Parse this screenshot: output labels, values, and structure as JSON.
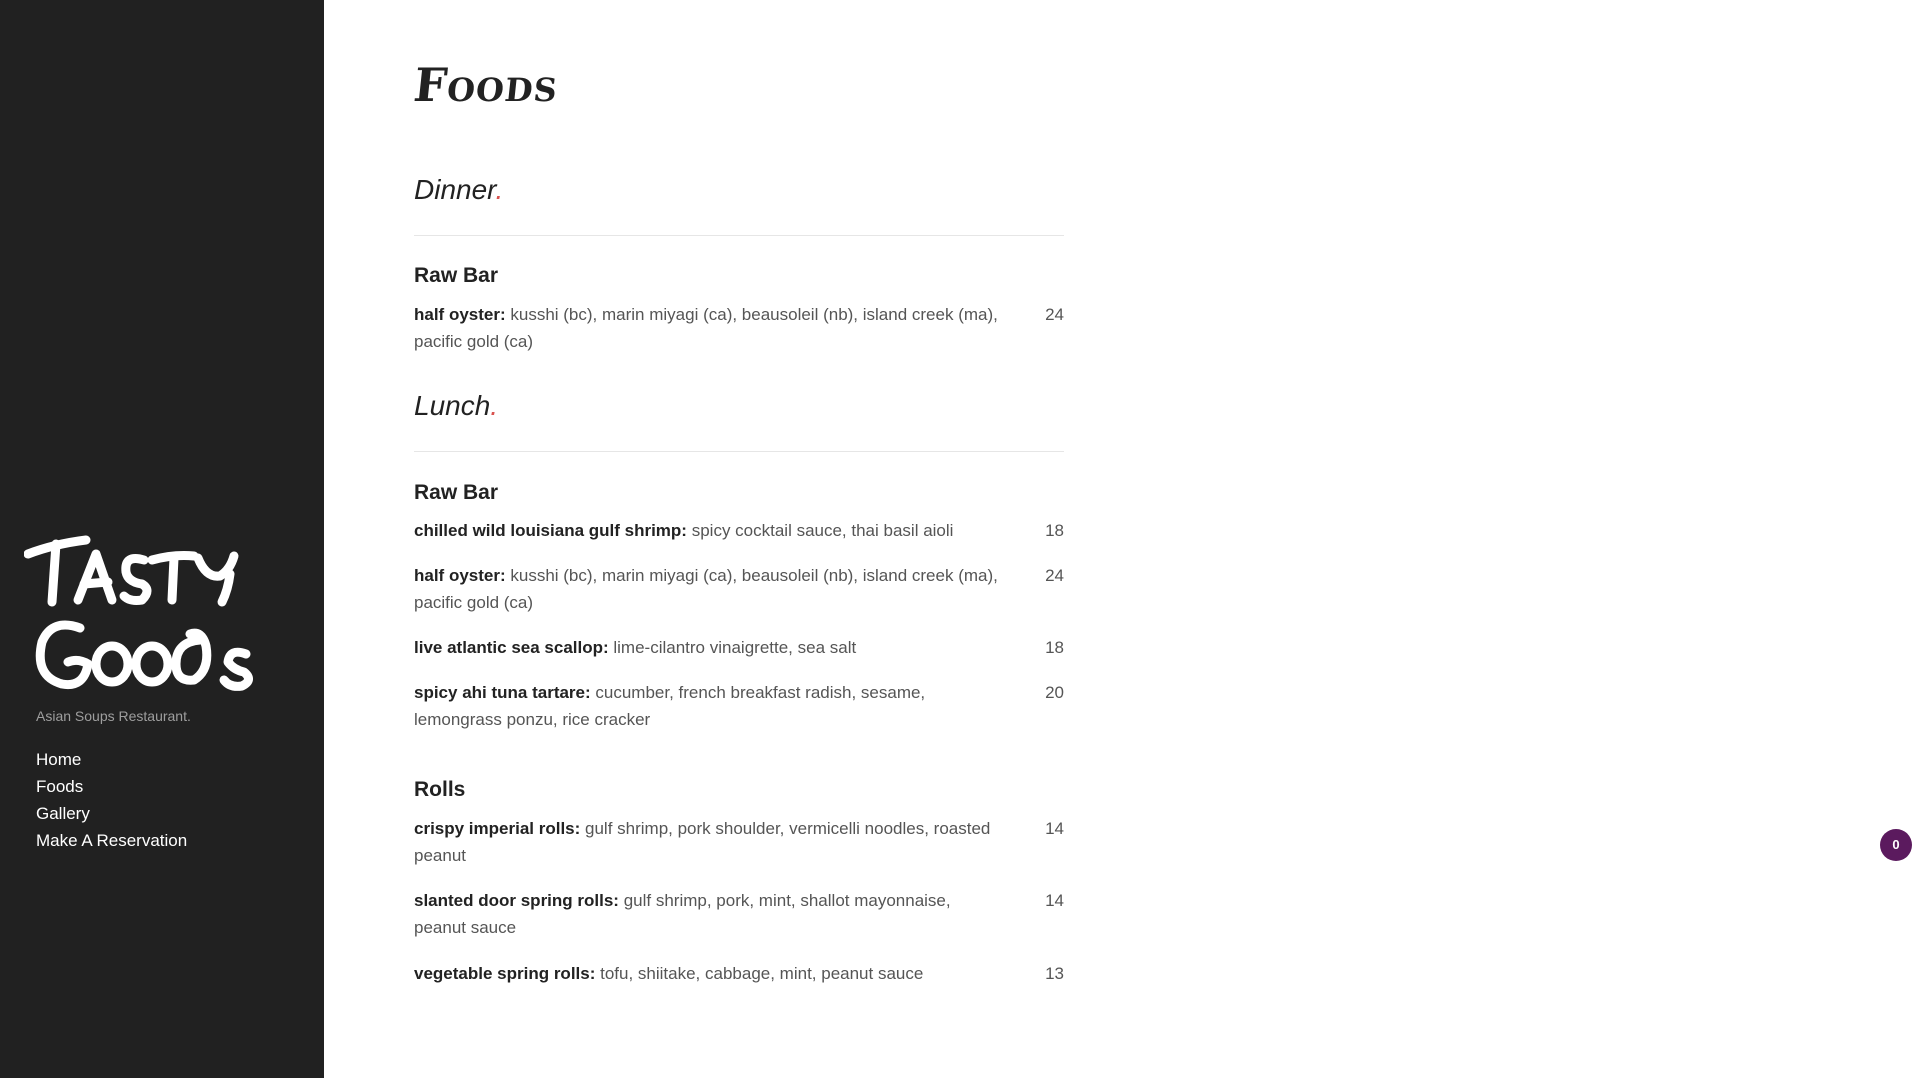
{
  "brand": {
    "logo_text": "Tasty Goods",
    "tagline": "Asian Soups Restaurant."
  },
  "nav": {
    "items": [
      "Home",
      "Foods",
      "Gallery",
      "Make A Reservation"
    ]
  },
  "page": {
    "title": "Foods"
  },
  "sections": {
    "dinner": {
      "title": "Dinner",
      "dot": ".",
      "raw_bar": {
        "title": "Raw Bar",
        "items": [
          {
            "name": "half oyster:",
            "desc": " kusshi (bc), marin miyagi (ca), beausoleil (nb), island creek (ma), pacific gold (ca)",
            "price": "24"
          }
        ]
      }
    },
    "lunch": {
      "title": "Lunch",
      "dot": ".",
      "raw_bar": {
        "title": "Raw Bar",
        "items": [
          {
            "name": "chilled wild louisiana gulf shrimp:",
            "desc": " spicy cocktail sauce, thai basil aioli",
            "price": "18"
          },
          {
            "name": "half oyster:",
            "desc": " kusshi (bc), marin miyagi (ca), beausoleil (nb), island creek (ma), pacific gold (ca)",
            "price": "24"
          },
          {
            "name": "live atlantic sea scallop:",
            "desc": " lime-cilantro vinaigrette, sea salt",
            "price": "18"
          },
          {
            "name": "spicy ahi tuna tartare:",
            "desc": " cucumber, french breakfast radish, sesame, lemongrass ponzu, rice cracker",
            "price": "20"
          }
        ]
      },
      "rolls": {
        "title": "Rolls",
        "items": [
          {
            "name": "crispy imperial rolls:",
            "desc": " gulf shrimp, pork shoulder, vermicelli noodles, roasted peanut",
            "price": "14"
          },
          {
            "name": "slanted door spring rolls:",
            "desc": " gulf shrimp, pork, mint, shallot mayonnaise, peanut sauce",
            "price": "14"
          },
          {
            "name": "vegetable spring rolls:",
            "desc": " tofu, shiitake, cabbage, mint, peanut sauce",
            "price": "13"
          }
        ]
      }
    }
  },
  "cart": {
    "count": "0"
  },
  "colors": {
    "sidebar_bg": "#212121",
    "accent_dot": "#d9534f",
    "cart_badge": "#5b1a5e"
  }
}
